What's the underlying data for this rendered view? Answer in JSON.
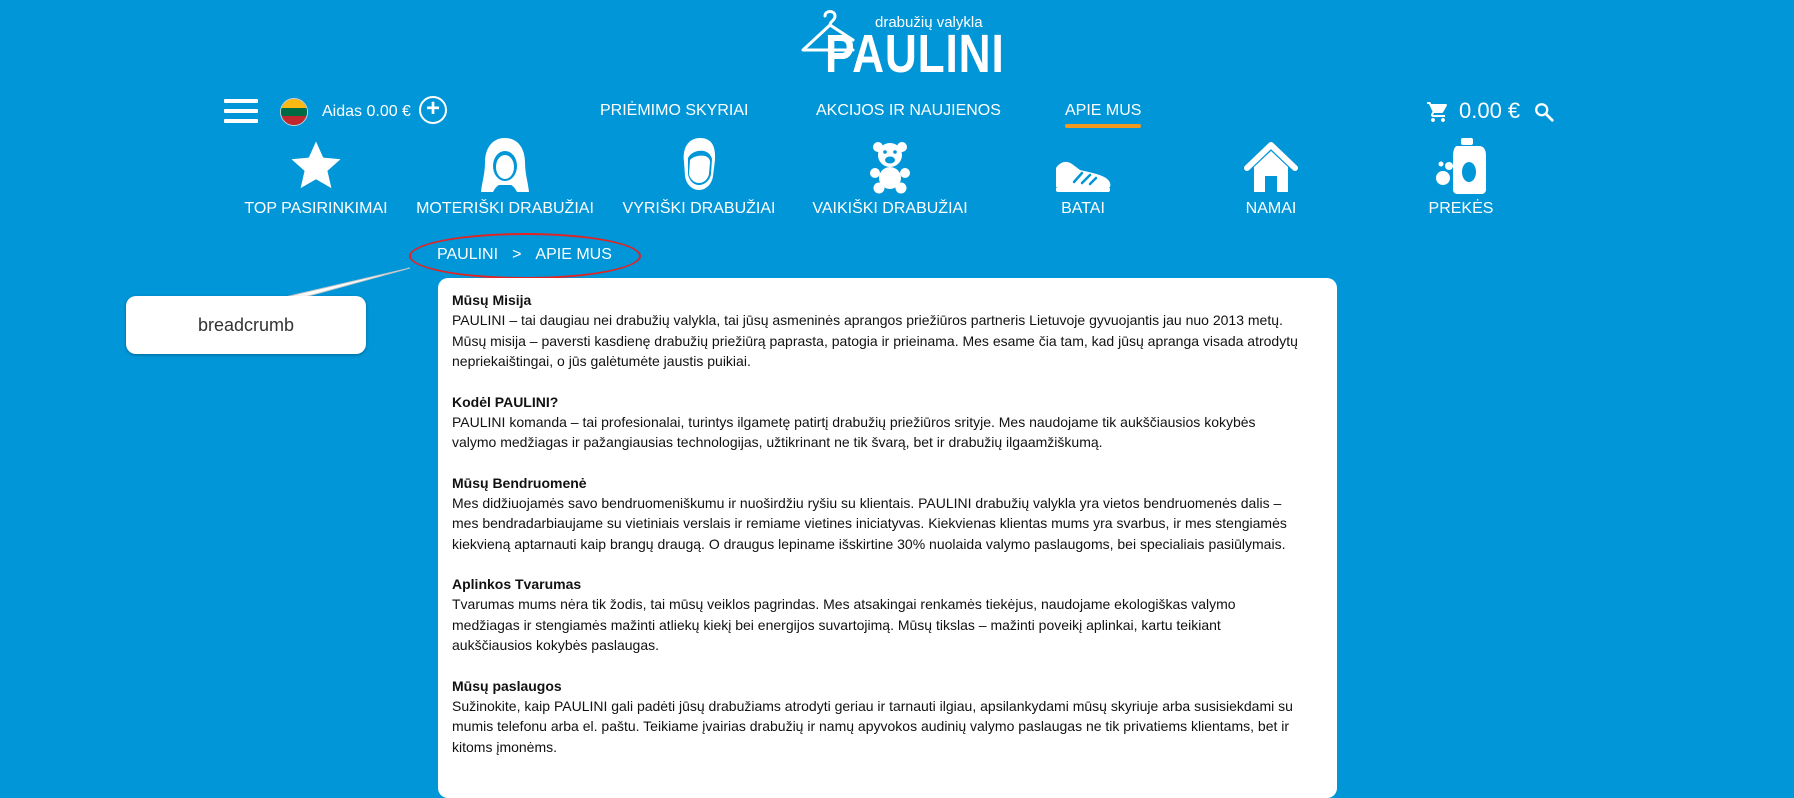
{
  "logo": {
    "tagline": "drabužių valykla",
    "brand": "PAULINI"
  },
  "topbar": {
    "menu_icon": "hamburger-icon",
    "flag_colors": [
      "#fdb913",
      "#006a44",
      "#c1272d"
    ],
    "user_label": "Aidas 0.00 €",
    "add_icon": "plus-circle-icon",
    "nav": [
      {
        "label": "PRIĖMIMO SKYRIAI"
      },
      {
        "label": "AKCIJOS IR NAUJIENOS"
      },
      {
        "label": "APIE MUS",
        "active": true
      }
    ],
    "cart_icon": "cart-icon",
    "cart_total": "0.00 €",
    "search_icon": "search-icon",
    "accent_color": "#f39a1e"
  },
  "categories": [
    {
      "label": "TOP PASIRINKIMAI",
      "icon": "star-icon"
    },
    {
      "label": "MOTERIŠKI DRABUŽIAI",
      "icon": "woman-icon"
    },
    {
      "label": "VYRIŠKI DRABUŽIAI",
      "icon": "man-icon"
    },
    {
      "label": "VAIKIŠKI DRABUŽIAI",
      "icon": "teddy-bear-icon"
    },
    {
      "label": "BATAI",
      "icon": "shoe-icon"
    },
    {
      "label": "NAMAI",
      "icon": "home-icon"
    },
    {
      "label": "PREKĖS",
      "icon": "detergent-icon"
    }
  ],
  "breadcrumb": {
    "items": [
      "PAULINI",
      "APIE MUS"
    ],
    "separator": ">"
  },
  "annotation": {
    "label": "breadcrumb",
    "color": "#e32222"
  },
  "content": {
    "sections": [
      {
        "title": "Mūsų Misija",
        "lines": [
          "PAULINI – tai daugiau nei drabužių valykla, tai jūsų asmeninės aprangos priežiūros partneris Lietuvoje gyvuojantis jau nuo 2013 metų.",
          "Mūsų misija – paversti kasdienę drabužių priežiūrą paprasta, patogia ir prieinama. Mes esame čia tam, kad jūsų apranga visada atrodytų",
          "nepriekaištingai, o jūs galėtumėte jaustis puikiai."
        ]
      },
      {
        "title": "Kodėl PAULINI?",
        "lines": [
          "PAULINI komanda – tai profesionalai, turintys ilgametę patirtį drabužių priežiūros srityje. Mes naudojame tik aukščiausios kokybės",
          "valymo medžiagas ir pažangiausias technologijas, užtikrinant ne tik švarą, bet ir drabužių ilgaamžiškumą."
        ]
      },
      {
        "title": "Mūsų Bendruomenė",
        "lines": [
          "Mes didžiuojamės savo bendruomeniškumu ir nuoširdžiu ryšiu su klientais. PAULINI drabužių valykla yra vietos bendruomenės dalis –",
          "mes bendradarbiaujame su vietiniais verslais ir remiame vietines iniciatyvas. Kiekvienas klientas mums yra svarbus, ir mes stengiamės",
          "kiekvieną aptarnauti kaip brangų draugą. O draugus lepiname išskirtine 30% nuolaida valymo paslaugoms, bei specialiais pasiūlymais."
        ]
      },
      {
        "title": "Aplinkos Tvarumas",
        "lines": [
          "Tvarumas mums nėra tik žodis, tai mūsų veiklos pagrindas. Mes atsakingai renkamės tiekėjus, naudojame ekologiškas valymo",
          "medžiagas ir stengiamės mažinti atliekų kiekį bei energijos suvartojimą. Mūsų tikslas – mažinti poveikį aplinkai, kartu teikiant",
          "aukščiausios kokybės paslaugas."
        ]
      },
      {
        "title": "Mūsų paslaugos",
        "lines": [
          "Sužinokite, kaip PAULINI gali padėti jūsų drabužiams atrodyti geriau ir tarnauti ilgiau, apsilankydami mūsų skyriuje arba susisiekdami su",
          "mumis telefonu arba el. paštu. Teikiame įvairias drabužių ir namų apyvokos audinių valymo paslaugas ne tik privatiems klientams, bet ir",
          "kitoms įmonėms."
        ]
      }
    ]
  }
}
